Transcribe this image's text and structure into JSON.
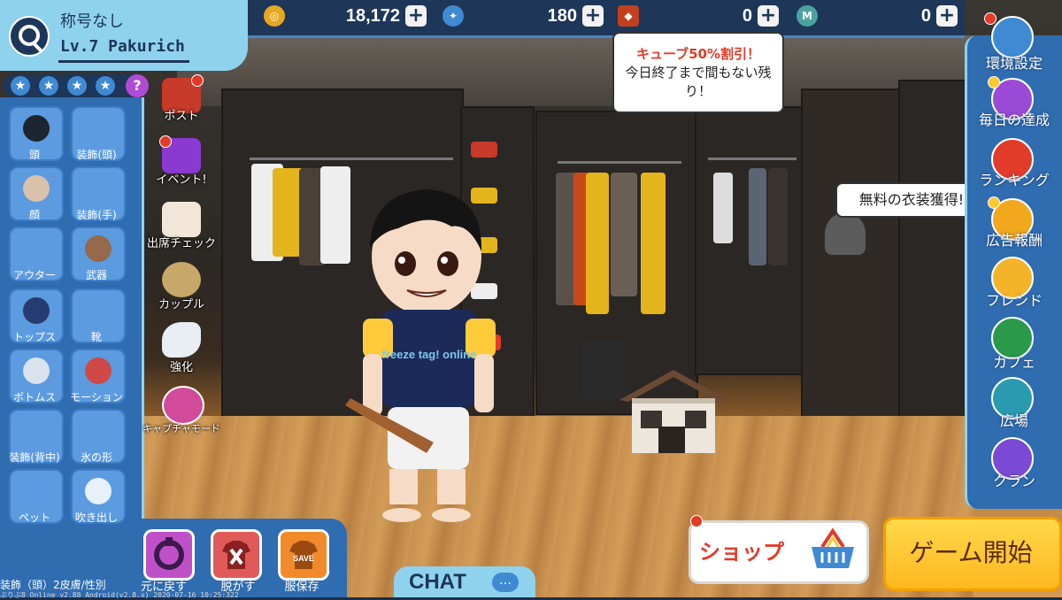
{
  "profile": {
    "title": "称号なし",
    "name": "Lv.7 Pakurich",
    "stars": [
      "★",
      "★",
      "★",
      "★"
    ],
    "help": "?"
  },
  "resources": [
    {
      "icon": "coin-icon",
      "color": "#e6a822",
      "value": "18,172"
    },
    {
      "icon": "bird-icon",
      "color": "#3f8ad3",
      "value": "180"
    },
    {
      "icon": "cube-icon",
      "color": "#c2401e",
      "value": "0"
    },
    {
      "icon": "m-token-icon",
      "color": "#4aa3a0",
      "value": "0"
    }
  ],
  "left_slots": [
    {
      "label": "頭"
    },
    {
      "label": "装飾(頭)"
    },
    {
      "label": "顔"
    },
    {
      "label": "装飾(手)"
    },
    {
      "label": "アウター"
    },
    {
      "label": "武器"
    },
    {
      "label": "トップス"
    },
    {
      "label": "靴"
    },
    {
      "label": "ボトムス"
    },
    {
      "label": "モーション"
    },
    {
      "label": "装飾(背中)"
    },
    {
      "label": "氷の形"
    },
    {
      "label": "ペット"
    },
    {
      "label": "吹き出し"
    }
  ],
  "skin_label": "装飾（頭）2皮膚/性別",
  "bottom_buttons": {
    "reset": "元に戻す",
    "undress": "脱がす",
    "save": "服保存",
    "save_badge": "SAVE"
  },
  "chat_label": "CHAT",
  "room_menu": {
    "post": "ポスト",
    "event": "イベント!",
    "attendance": "出席チェック",
    "couple": "カップル",
    "enhance": "強化",
    "capture": "キャプチャモード"
  },
  "bubble_sale": {
    "highlight": "キューブ50%割引！",
    "text": "今日終了まで間もない残り！"
  },
  "bubble_ad": "無料の衣装獲得!",
  "right_menu": {
    "settings": "環境設定",
    "daily": "毎日の達成",
    "ranking": "ランキング",
    "ad_reward": "広告報酬",
    "friends": "フレンド",
    "cafe": "カフェ",
    "plaza": "広場",
    "clan": "クラン"
  },
  "shirt_text": "freeze tag! online",
  "shop_label": "ショップ",
  "start_label": "ゲーム開始",
  "version": "ぶりぶ8 Online v2.88 Android(v2.8.x) 2020-07-16 10:25:322",
  "colors": {
    "accent": "#2f6cb0",
    "light_blue": "#8fd2ee",
    "start_yellow": "#ffc831",
    "alert_red": "#e23b2a"
  }
}
